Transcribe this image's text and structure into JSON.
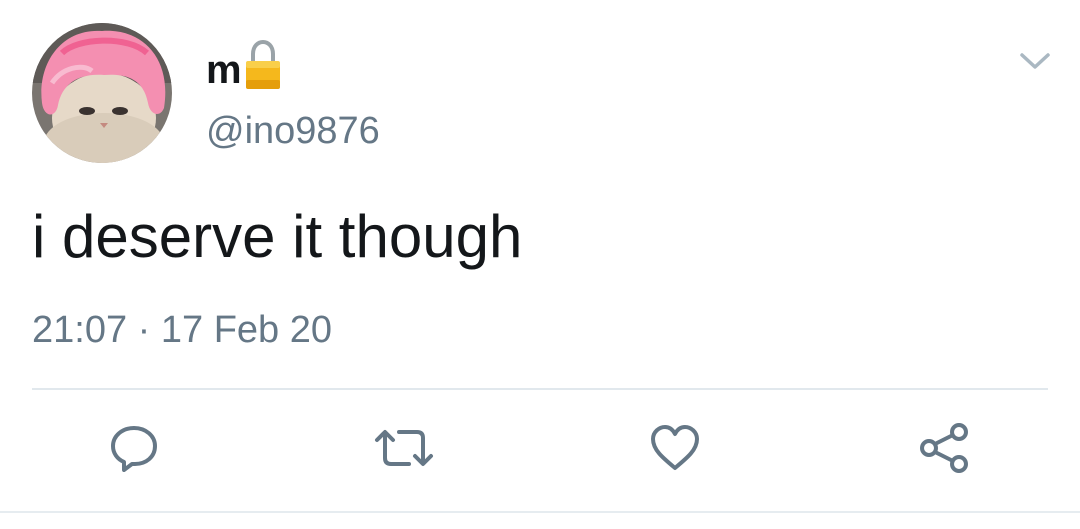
{
  "tweet": {
    "display_name": "m",
    "handle": "@ino9876",
    "text": "i deserve it though",
    "timestamp": "21:07 · 17 Feb 20",
    "protected_icon": "lock-icon",
    "avatar_description_icon": "avatar"
  },
  "actions": [
    {
      "icon": "reply-icon"
    },
    {
      "icon": "retweet-icon"
    },
    {
      "icon": "like-icon"
    },
    {
      "icon": "share-icon"
    }
  ],
  "colors": {
    "text_primary": "#14171a",
    "text_secondary": "#657786",
    "icon_gray": "#657786",
    "divider": "#e1e8ed",
    "lock_gold": "#f5b81c"
  }
}
